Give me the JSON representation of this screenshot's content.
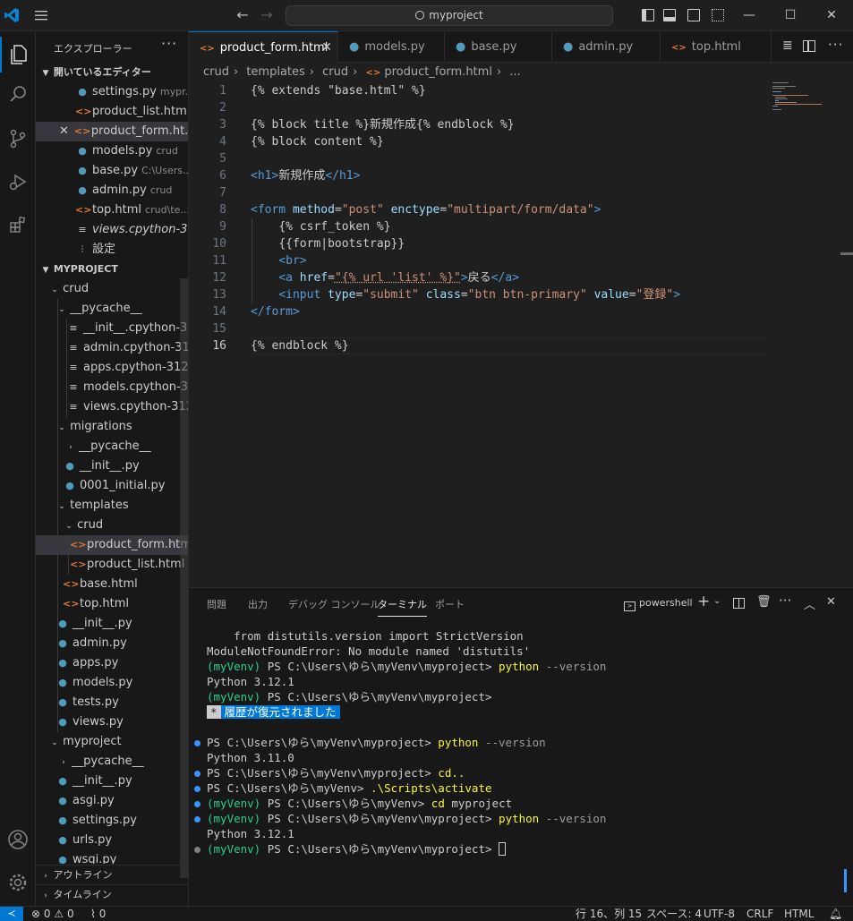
{
  "window": {
    "search": "myproject"
  },
  "sidebar": {
    "title": "エクスプローラー",
    "open_editors_label": "開いているエディター",
    "open_editors": [
      {
        "name": "settings.py",
        "desc": "mypr...",
        "type": "py"
      },
      {
        "name": "product_list.htm...",
        "desc": "",
        "type": "html"
      },
      {
        "name": "product_form.ht...",
        "desc": "",
        "type": "html"
      },
      {
        "name": "models.py",
        "desc": "crud",
        "type": "py"
      },
      {
        "name": "base.py",
        "desc": "C:\\Users...",
        "type": "py"
      },
      {
        "name": "admin.py",
        "desc": "crud",
        "type": "py"
      },
      {
        "name": "top.html",
        "desc": "crud\\te...",
        "type": "html"
      },
      {
        "name": "views.cpython-3...",
        "desc": "",
        "type": "lines"
      },
      {
        "name": "設定",
        "desc": "",
        "type": "settings"
      }
    ],
    "project_label": "MYPROJECT",
    "tree": [
      "crud",
      "__pycache__",
      "__init__.cpython-31...",
      "admin.cpython-31...",
      "apps.cpython-312...",
      "models.cpython-3...",
      "views.cpython-312...",
      "migrations",
      "__pycache__",
      "__init__.py",
      "0001_initial.py",
      "templates",
      "crud",
      "product_form.html",
      "product_list.html",
      "base.html",
      "top.html",
      "__init__.py",
      "admin.py",
      "apps.py",
      "models.py",
      "tests.py",
      "views.py",
      "myproject",
      "__pycache__",
      "__init__.py",
      "asgi.py",
      "settings.py",
      "urls.py",
      "wsgi.py"
    ],
    "outline_label": "アウトライン",
    "timeline_label": "タイムライン"
  },
  "tabs": [
    "product_form.html",
    "models.py",
    "base.py",
    "admin.py",
    "top.html"
  ],
  "breadcrumb": [
    "crud",
    "templates",
    "crud",
    "product_form.html",
    "..."
  ],
  "code": {
    "line_numbers": [
      "1",
      "2",
      "3",
      "4",
      "5",
      "6",
      "7",
      "8",
      "9",
      "10",
      "11",
      "12",
      "13",
      "14",
      "15",
      "16"
    ],
    "l1": "{% extends \"base.html\" %}",
    "l3": "{% block title %}新規作成{% endblock %}",
    "l4": "{% block content %}",
    "l6a": "<h1>",
    "l6b": "新規作成",
    "l6c": "</h1>",
    "l8": {
      "tag_open": "<form",
      "attr1": "method",
      "val1": "\"post\"",
      "attr2": "enctype",
      "val2": "\"multipart/form/data\"",
      "tag_close": ">"
    },
    "l9": "{% csrf_token %}",
    "l10": "{{form|bootstrap}}",
    "l11": "<br>",
    "l12": {
      "open": "<a",
      "attr": "href",
      "val": "\"{% url 'list' %}\"",
      "text": "戻る",
      "close": "</a>"
    },
    "l13": {
      "open": "<input",
      "a1": "type",
      "v1": "\"submit\"",
      "a2": "class",
      "v2": "\"btn btn-primary\"",
      "a3": "value",
      "v3": "\"登録\"",
      "close": ">"
    },
    "l14": "</form>",
    "l16": "{% endblock %}"
  },
  "panel": {
    "tabs": [
      "問題",
      "出力",
      "デバッグ コンソール",
      "ターミナル",
      "ポート"
    ],
    "shell": "powershell",
    "lines": {
      "t1": "    from distutils.version import StrictVersion",
      "t2": "ModuleNotFoundError: No module named 'distutils'",
      "venv": "(myVenv)",
      "ps_proj": " PS C:\\Users\\ゆら\\myVenv\\myproject> ",
      "ps_venv": " PS C:\\Users\\ゆら\\myVenv> ",
      "python": "python",
      "version_flag": " --version",
      "py3121": "Python 3.12.1",
      "py3110": "Python 3.11.0",
      "restored_star": "*",
      "restored": "履歴が復元されました",
      "ps_plain_proj": "PS C:\\Users\\ゆら\\myVenv\\myproject> ",
      "ps_plain_venv": "PS C:\\Users\\ゆら\\myVenv> ",
      "cd_up": "cd..",
      "activate": ".\\Scripts\\activate",
      "cd": "cd",
      "cd_arg": " myproject"
    }
  },
  "status": {
    "errors": "0",
    "warnings": "0",
    "ports": "0",
    "position": "行 16、列 15",
    "spaces": "スペース: 4",
    "encoding": "UTF-8",
    "eol": "CRLF",
    "language": "HTML"
  },
  "colors": {
    "accent": "#0078d4",
    "venv": "#23d18b",
    "command": "#f5f543"
  }
}
